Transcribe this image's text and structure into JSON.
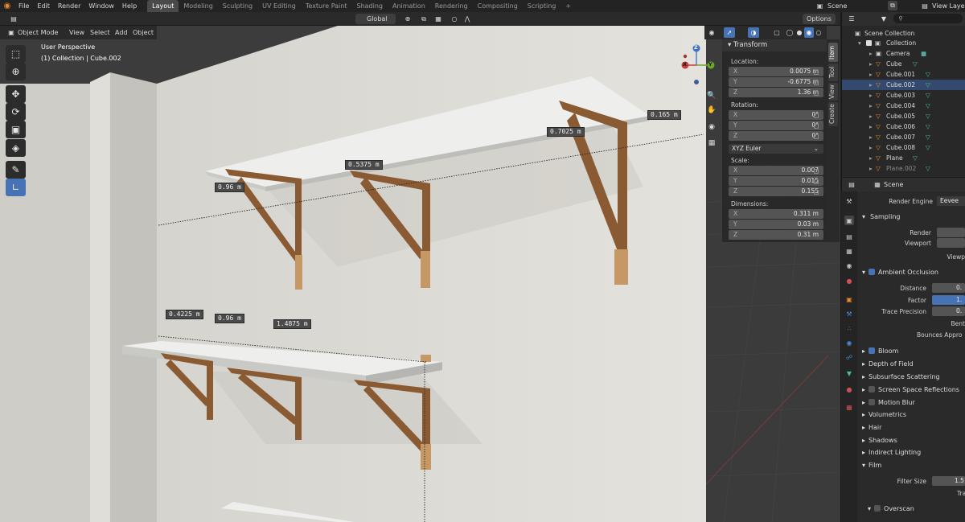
{
  "topbar": {
    "menus": [
      "File",
      "Edit",
      "Render",
      "Window",
      "Help"
    ],
    "workspaces": [
      "Layout",
      "Modeling",
      "Sculpting",
      "UV Editing",
      "Texture Paint",
      "Shading",
      "Animation",
      "Rendering",
      "Compositing",
      "Scripting"
    ],
    "active_workspace": "Layout",
    "add_tab": "+",
    "scene": "Scene",
    "view_layer": "View Layer"
  },
  "viewport_header": {
    "mode": "Object Mode",
    "menus": [
      "View",
      "Select",
      "Add",
      "Object"
    ],
    "orientation": "Global",
    "options": "Options"
  },
  "overlay_text": {
    "perspective": "User Perspective",
    "collection": "(1) Collection | Cube.002"
  },
  "measurements": [
    {
      "text": "0.165 m"
    },
    {
      "text": "0.7025 m"
    },
    {
      "text": "0.5375 m"
    },
    {
      "text": "0.96 m"
    },
    {
      "text": "0.4225 m"
    },
    {
      "text": "0.96 m"
    },
    {
      "text": "1.4875 m"
    }
  ],
  "npanel": {
    "header": "Transform",
    "location_label": "Location:",
    "location": {
      "x": "0.0075 m",
      "y": "-0.6775 m",
      "z": "1.36 m"
    },
    "rotation_label": "Rotation:",
    "rotation": {
      "x": "0°",
      "y": "0°",
      "z": "0°"
    },
    "rotation_mode": "XYZ Euler",
    "scale_label": "Scale:",
    "scale": {
      "x": "0.007",
      "y": "0.015",
      "z": "0.155"
    },
    "dimensions_label": "Dimensions:",
    "dimensions": {
      "x": "0.311 m",
      "y": "0.03 m",
      "z": "0.31 m"
    },
    "axis": {
      "x": "X",
      "y": "Y",
      "z": "Z"
    },
    "tabs": [
      "Item",
      "Tool",
      "View",
      "Create"
    ]
  },
  "outliner": {
    "root": "Scene Collection",
    "collection": "Collection",
    "items": [
      "Camera",
      "Cube",
      "Cube.001",
      "Cube.002",
      "Cube.003",
      "Cube.004",
      "Cube.005",
      "Cube.006",
      "Cube.007",
      "Cube.008",
      "Plane",
      "Plane.002"
    ],
    "selected": "Cube.002"
  },
  "properties": {
    "context": "Scene",
    "render_engine_label": "Render Engine",
    "render_engine": "Eevee",
    "sampling": "Sampling",
    "render_label": "Render",
    "viewport_label": "Viewport",
    "viewport_denoise_label": "Viewp",
    "ao": "Ambient Occlusion",
    "distance_label": "Distance",
    "distance_val": "0.",
    "factor_label": "Factor",
    "factor_val": "1.",
    "trace_label": "Trace Precision",
    "trace_val": "0.",
    "bent_label": "Bent",
    "bounces_label": "Bounces Appro",
    "sections": [
      "Bloom",
      "Depth of Field",
      "Subsurface Scattering",
      "Screen Space Reflections",
      "Motion Blur",
      "Volumetrics",
      "Hair",
      "Shadows",
      "Indirect Lighting",
      "Film"
    ],
    "filter_size_label": "Filter Size",
    "filter_size_val": "1.5",
    "transparent_label": "Tra",
    "overscan": "Overscan"
  },
  "colors": {
    "accent": "#4772b3",
    "selected_row": "#334a6e",
    "wall": "#dddbd5",
    "wood": "#8a5a32"
  },
  "icons": {
    "gizmo_x": "X",
    "gizmo_y": "Y",
    "gizmo_z": "Z"
  }
}
